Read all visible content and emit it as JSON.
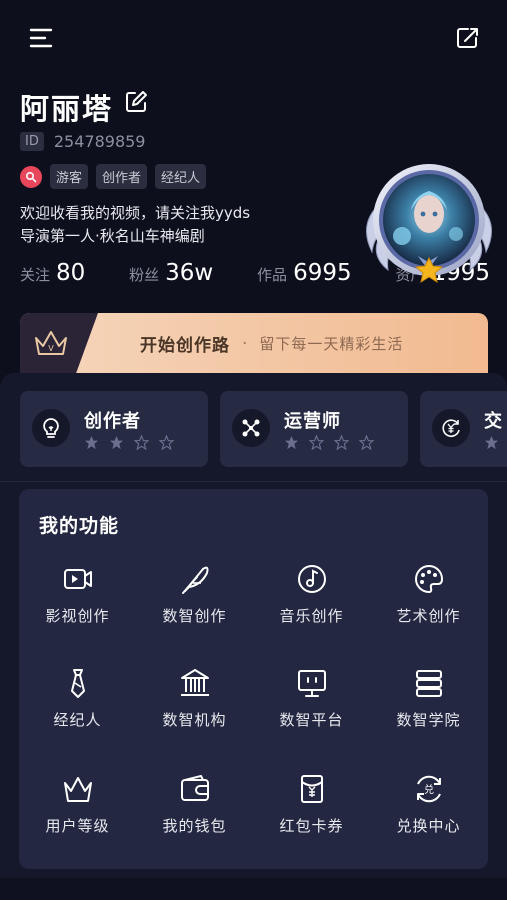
{
  "header": {
    "menu_icon": "menu-icon",
    "share_icon": "share-icon"
  },
  "profile": {
    "name": "阿丽塔",
    "id_label": "ID",
    "id_value": "254789859",
    "tags": [
      "游客",
      "创作者",
      "经纪人"
    ],
    "bio_line1": "欢迎收看我的视频，请关注我yyds",
    "bio_line2": "导演第一人·秋名山车神编剧",
    "stats": [
      {
        "label": "关注",
        "value": "80"
      },
      {
        "label": "粉丝",
        "value": "36w"
      },
      {
        "label": "作品",
        "value": "6995"
      },
      {
        "label": "资产",
        "value": "1995"
      }
    ]
  },
  "banner": {
    "title": "开始创作路",
    "dot": "·",
    "subtitle": "留下每一天精彩生活",
    "badge": "V"
  },
  "roles": [
    {
      "name": "创作者",
      "icon": "lightbulb-icon",
      "stars_filled": 2,
      "stars_total": 4
    },
    {
      "name": "运营师",
      "icon": "network-icon",
      "stars_filled": 1,
      "stars_total": 4
    },
    {
      "name": "交",
      "icon": "yuan-cycle-icon",
      "stars_filled": 1,
      "stars_total": 4
    }
  ],
  "functions": {
    "title": "我的功能",
    "items": [
      {
        "label": "影视创作",
        "icon": "video-icon"
      },
      {
        "label": "数智创作",
        "icon": "feather-icon"
      },
      {
        "label": "音乐创作",
        "icon": "music-icon"
      },
      {
        "label": "艺术创作",
        "icon": "palette-icon"
      },
      {
        "label": "经纪人",
        "icon": "tie-icon"
      },
      {
        "label": "数智机构",
        "icon": "institution-icon"
      },
      {
        "label": "数智平台",
        "icon": "monitor-icon"
      },
      {
        "label": "数智学院",
        "icon": "books-icon"
      },
      {
        "label": "用户等级",
        "icon": "crown-icon"
      },
      {
        "label": "我的钱包",
        "icon": "wallet-icon"
      },
      {
        "label": "红包卡券",
        "icon": "red-packet-icon"
      },
      {
        "label": "兑换中心",
        "icon": "exchange-icon"
      }
    ]
  },
  "colors": {
    "background": "#0d0f1d",
    "card": "#262a42",
    "panel": "#232741",
    "banner_accent": "#f3c9a8",
    "tag_red": "#e8475b",
    "star_gold": "#f5b51c"
  }
}
